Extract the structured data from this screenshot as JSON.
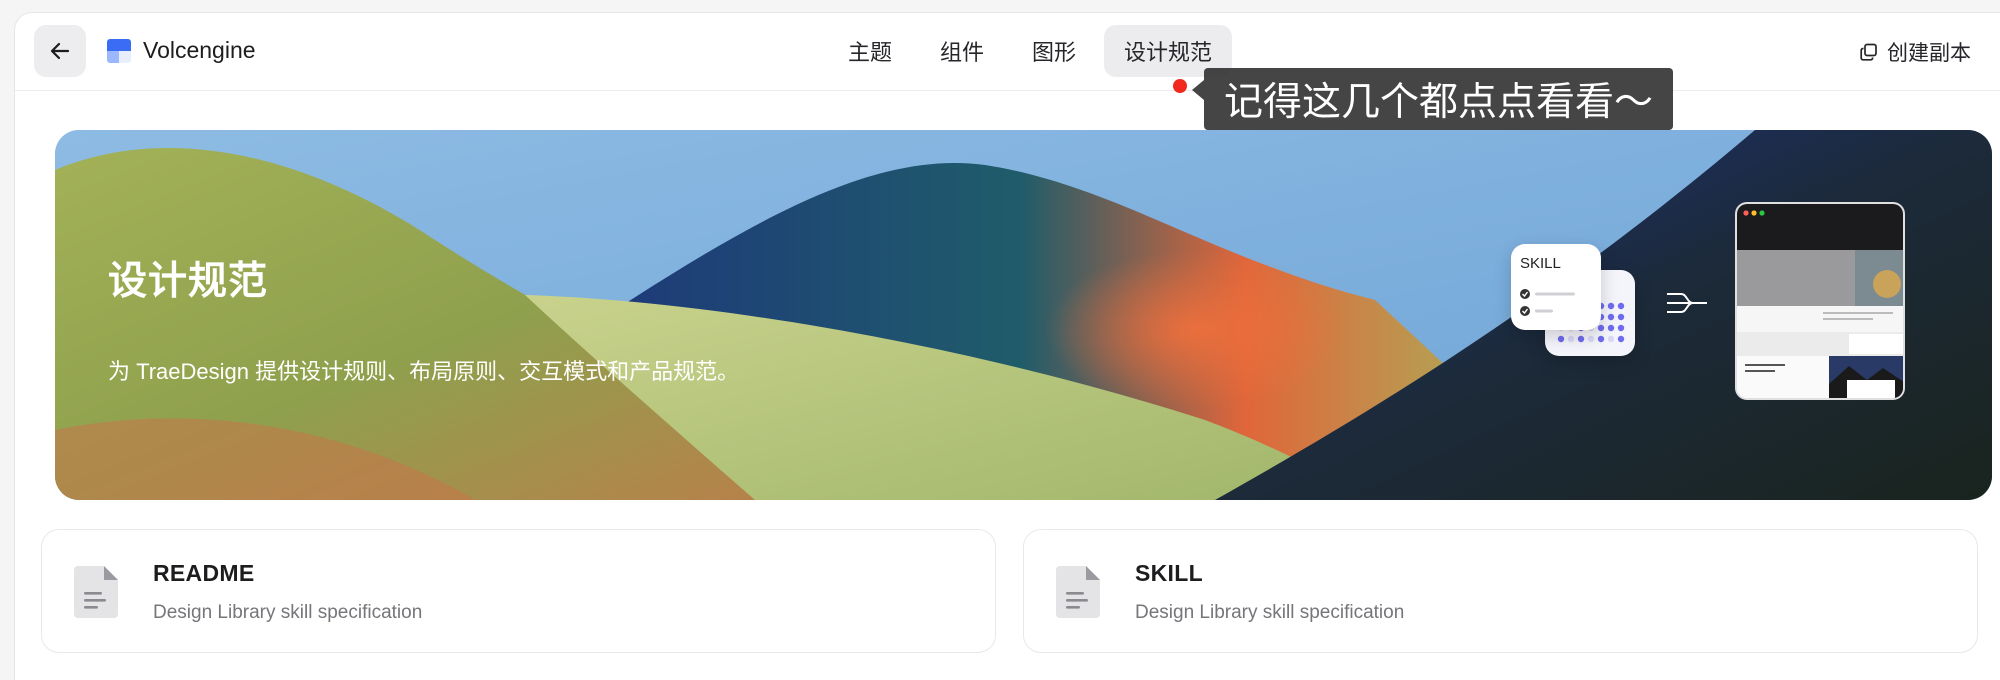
{
  "header": {
    "back_icon": "arrow-left-icon",
    "brand_name": "Volcengine",
    "nav": [
      {
        "label": "主题",
        "active": false
      },
      {
        "label": "组件",
        "active": false
      },
      {
        "label": "图形",
        "active": false
      },
      {
        "label": "设计规范",
        "active": true
      }
    ],
    "copy_label": "创建副本",
    "copy_icon": "copy-icon"
  },
  "tooltip": {
    "text": "记得这几个都点点看看～",
    "dot_color": "#f0281e"
  },
  "hero": {
    "title": "设计规范",
    "description": "为 TraeDesign 提供设计规则、布局原则、交互模式和产品规范。",
    "skill_card_label": "SKILL"
  },
  "cards": [
    {
      "title": "README",
      "description": "Design Library skill specification",
      "icon": "document-icon"
    },
    {
      "title": "SKILL",
      "description": "Design Library skill specification",
      "icon": "document-icon"
    }
  ],
  "colors": {
    "accent": "#3b6cf6",
    "nav_active_bg": "#ececee",
    "text_primary": "#1d1d1f",
    "text_secondary": "#75757a"
  }
}
